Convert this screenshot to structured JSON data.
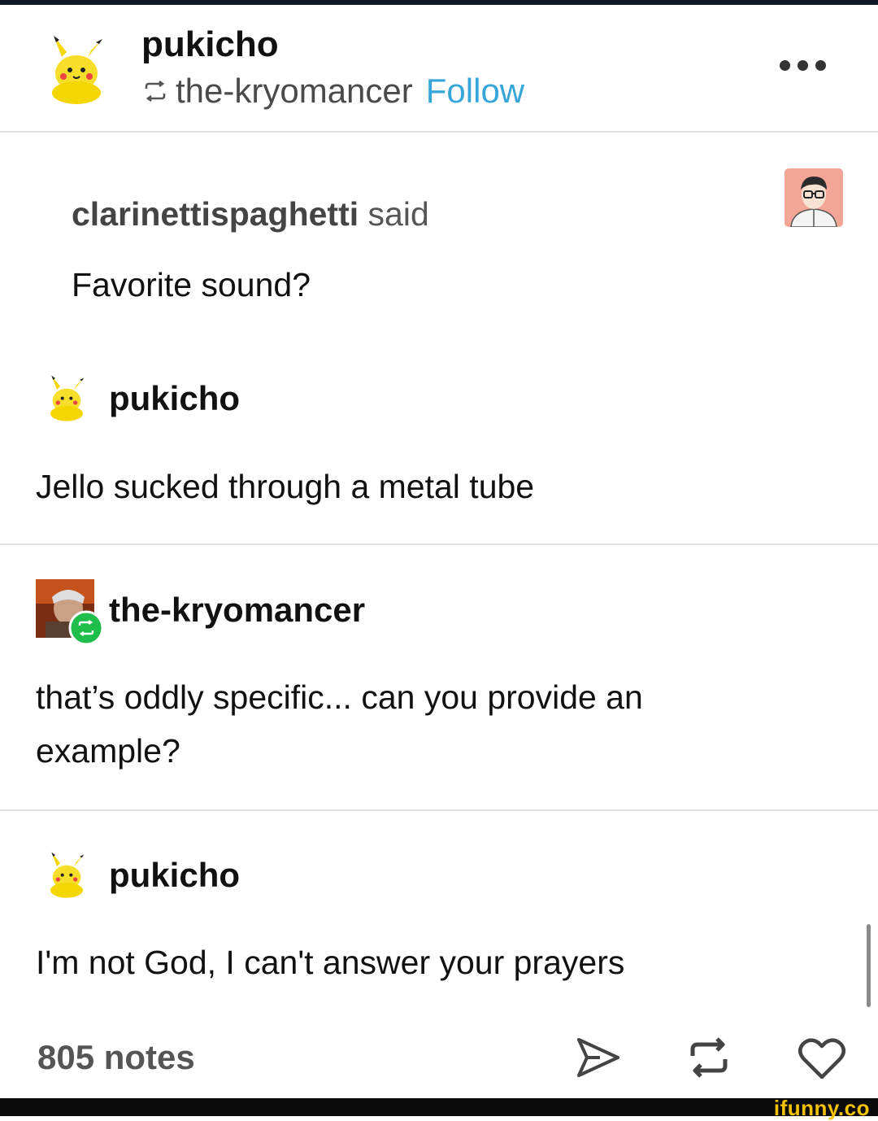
{
  "header": {
    "username": "pukicho",
    "reblogged_from": "the-kryomancer",
    "follow_label": "Follow",
    "avatar_icon": "pikachu-plush-avatar",
    "more_icon": "more-dots-icon"
  },
  "ask": {
    "asker": "clarinettispaghetti",
    "said": "said",
    "question": "Favorite sound?",
    "asker_avatar_icon": "person-glasses-avatar"
  },
  "thread": [
    {
      "username": "pukicho",
      "text": "Jello sucked through a metal tube",
      "avatar_icon": "pikachu-plush-avatar"
    },
    {
      "username": "the-kryomancer",
      "text": "that’s oddly specific... can you provide an example?",
      "avatar_icon": "photo-avatar"
    },
    {
      "username": "pukicho",
      "text": "I'm not God, I can't answer your prayers",
      "avatar_icon": "pikachu-plush-avatar"
    }
  ],
  "footer": {
    "notes": "805 notes",
    "share_icon": "send-icon",
    "reblog_icon": "reblog-icon",
    "like_icon": "heart-icon"
  },
  "watermark": "ifunny.co",
  "colors": {
    "follow": "#36a5d8",
    "reblog_badge": "#1fbe4a",
    "watermark": "#f2c200"
  }
}
